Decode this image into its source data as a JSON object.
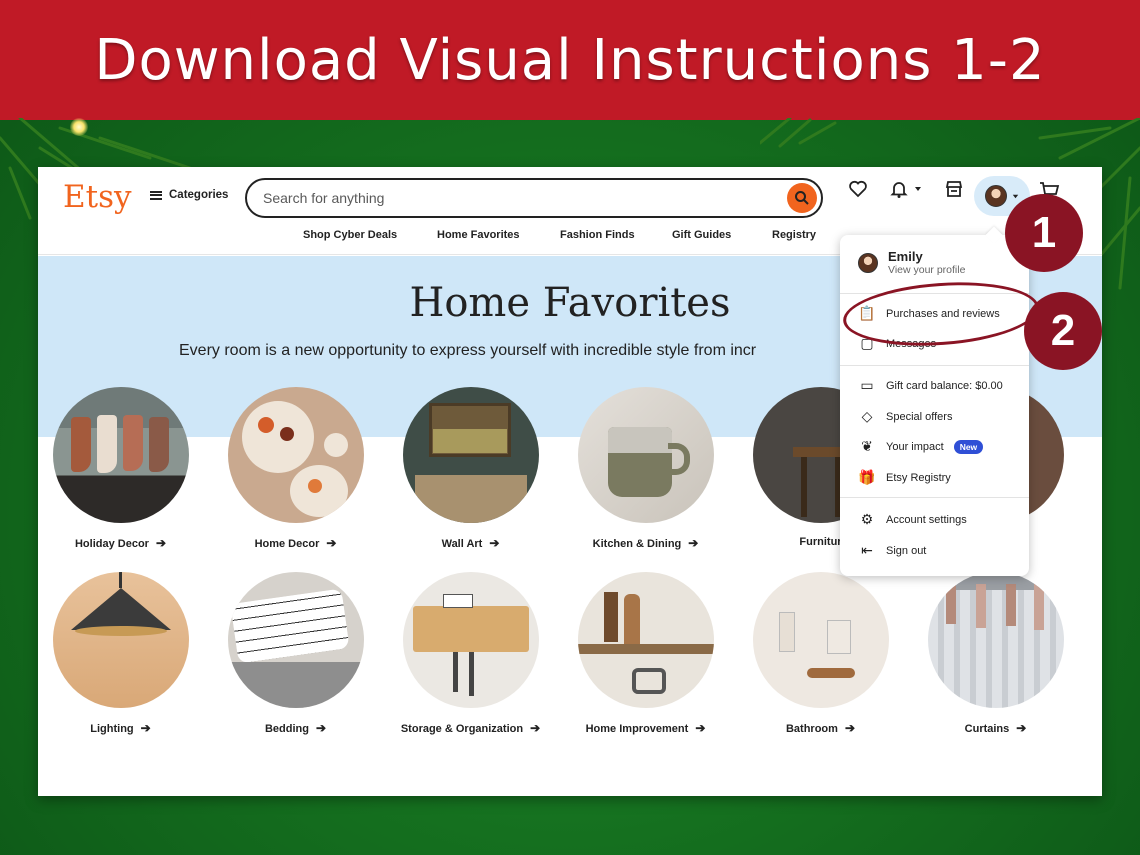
{
  "banner": {
    "title": "Download Visual Instructions 1-2"
  },
  "header": {
    "logo": "Etsy",
    "categories_label": "Categories",
    "search_placeholder": "Search for anything",
    "subnav": [
      "Shop Cyber Deals",
      "Home Favorites",
      "Fashion Finds",
      "Gift Guides",
      "Registry"
    ]
  },
  "hero": {
    "title": "Home Favorites",
    "subtitle": "Every room is a new opportunity to express yourself with incredible style from incr"
  },
  "categories": [
    {
      "label": "Holiday Decor",
      "icon": "stockings-photo"
    },
    {
      "label": "Home Decor",
      "icon": "plates-photo"
    },
    {
      "label": "Wall Art",
      "icon": "framed-art-photo"
    },
    {
      "label": "Kitchen & Dining",
      "icon": "mug-photo"
    },
    {
      "label": "Furnitur",
      "icon": "stool-photo"
    },
    {
      "label": "",
      "icon": "rug-photo"
    },
    {
      "label": "Lighting",
      "icon": "lamp-photo"
    },
    {
      "label": "Bedding",
      "icon": "pillows-photo"
    },
    {
      "label": "Storage & Organization",
      "icon": "pegboard-photo"
    },
    {
      "label": "Home Improvement",
      "icon": "shelf-photo"
    },
    {
      "label": "Bathroom",
      "icon": "bath-set-photo"
    },
    {
      "label": "Curtains",
      "icon": "curtain-photo"
    }
  ],
  "menu": {
    "user_name": "Emily",
    "profile_link": "View your profile",
    "items": {
      "purchases": "Purchases and reviews",
      "messages": "Messages",
      "gift_card": "Gift card balance: $0.00",
      "offers": "Special offers",
      "impact": "Your impact",
      "impact_badge": "New",
      "registry": "Etsy Registry",
      "settings": "Account settings",
      "signout": "Sign out"
    }
  },
  "annotations": {
    "step1": "1",
    "step2": "2"
  },
  "colors": {
    "banner": "#c01a26",
    "etsy_orange": "#f1641e",
    "hero_bg": "#cfe7f8",
    "annotation": "#8a1424",
    "badge": "#2f4fd6"
  }
}
